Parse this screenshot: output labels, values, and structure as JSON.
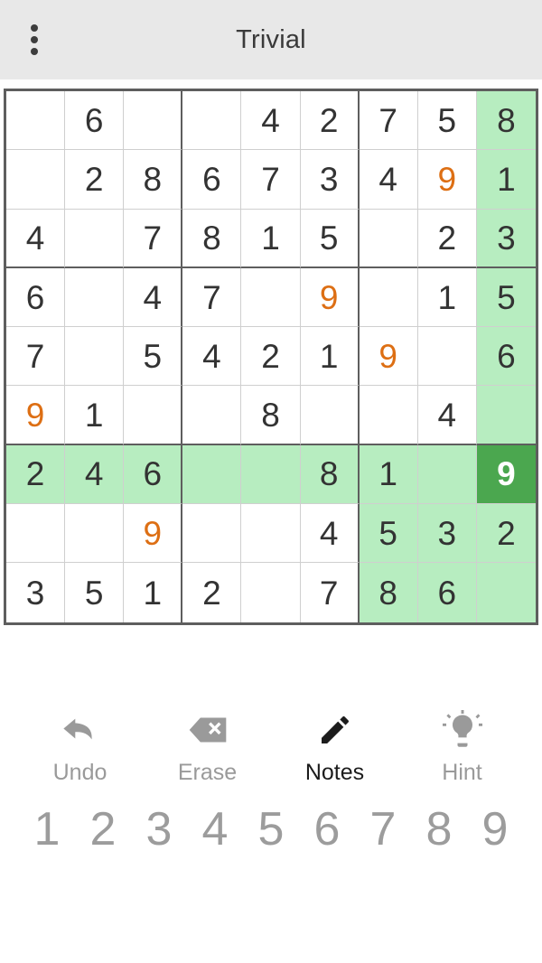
{
  "header": {
    "title": "Trivial",
    "menu_icon": "overflow-menu-icon"
  },
  "colors": {
    "accent_green": "#4BA74F",
    "highlight_green": "#B7EDC0",
    "user_entry_orange": "#DD6F14",
    "given_text": "#333333",
    "appbar_bg": "#E8E8E8",
    "grid_line": "#CFCFCF",
    "grid_border": "#5E5E5E",
    "numpad_text": "#9C9C9C"
  },
  "board": {
    "selected_cell": {
      "row": 6,
      "col": 8,
      "value": "9"
    },
    "rows": [
      [
        {
          "v": "",
          "t": "empty",
          "h": false
        },
        {
          "v": "6",
          "t": "given",
          "h": false
        },
        {
          "v": "",
          "t": "empty",
          "h": false
        },
        {
          "v": "",
          "t": "empty",
          "h": false
        },
        {
          "v": "4",
          "t": "given",
          "h": false
        },
        {
          "v": "2",
          "t": "given",
          "h": false
        },
        {
          "v": "7",
          "t": "given",
          "h": false
        },
        {
          "v": "5",
          "t": "given",
          "h": false
        },
        {
          "v": "8",
          "t": "given",
          "h": true
        }
      ],
      [
        {
          "v": "",
          "t": "empty",
          "h": false
        },
        {
          "v": "2",
          "t": "given",
          "h": false
        },
        {
          "v": "8",
          "t": "given",
          "h": false
        },
        {
          "v": "6",
          "t": "given",
          "h": false
        },
        {
          "v": "7",
          "t": "given",
          "h": false
        },
        {
          "v": "3",
          "t": "given",
          "h": false
        },
        {
          "v": "4",
          "t": "given",
          "h": false
        },
        {
          "v": "9",
          "t": "user",
          "h": false
        },
        {
          "v": "1",
          "t": "given",
          "h": true
        }
      ],
      [
        {
          "v": "4",
          "t": "given",
          "h": false
        },
        {
          "v": "",
          "t": "empty",
          "h": false
        },
        {
          "v": "7",
          "t": "given",
          "h": false
        },
        {
          "v": "8",
          "t": "given",
          "h": false
        },
        {
          "v": "1",
          "t": "given",
          "h": false
        },
        {
          "v": "5",
          "t": "given",
          "h": false
        },
        {
          "v": "",
          "t": "empty",
          "h": false
        },
        {
          "v": "2",
          "t": "given",
          "h": false
        },
        {
          "v": "3",
          "t": "given",
          "h": true
        }
      ],
      [
        {
          "v": "6",
          "t": "given",
          "h": false
        },
        {
          "v": "",
          "t": "empty",
          "h": false
        },
        {
          "v": "4",
          "t": "given",
          "h": false
        },
        {
          "v": "7",
          "t": "given",
          "h": false
        },
        {
          "v": "",
          "t": "empty",
          "h": false
        },
        {
          "v": "9",
          "t": "user",
          "h": false
        },
        {
          "v": "",
          "t": "empty",
          "h": false
        },
        {
          "v": "1",
          "t": "given",
          "h": false
        },
        {
          "v": "5",
          "t": "given",
          "h": true
        }
      ],
      [
        {
          "v": "7",
          "t": "given",
          "h": false
        },
        {
          "v": "",
          "t": "empty",
          "h": false
        },
        {
          "v": "5",
          "t": "given",
          "h": false
        },
        {
          "v": "4",
          "t": "given",
          "h": false
        },
        {
          "v": "2",
          "t": "given",
          "h": false
        },
        {
          "v": "1",
          "t": "given",
          "h": false
        },
        {
          "v": "9",
          "t": "user",
          "h": false
        },
        {
          "v": "",
          "t": "empty",
          "h": false
        },
        {
          "v": "6",
          "t": "given",
          "h": true
        }
      ],
      [
        {
          "v": "9",
          "t": "user",
          "h": false
        },
        {
          "v": "1",
          "t": "given",
          "h": false
        },
        {
          "v": "",
          "t": "empty",
          "h": false
        },
        {
          "v": "",
          "t": "empty",
          "h": false
        },
        {
          "v": "8",
          "t": "given",
          "h": false
        },
        {
          "v": "",
          "t": "empty",
          "h": false
        },
        {
          "v": "",
          "t": "empty",
          "h": false
        },
        {
          "v": "4",
          "t": "given",
          "h": false
        },
        {
          "v": "",
          "t": "empty",
          "h": true
        }
      ],
      [
        {
          "v": "2",
          "t": "given",
          "h": true
        },
        {
          "v": "4",
          "t": "given",
          "h": true
        },
        {
          "v": "6",
          "t": "given",
          "h": true
        },
        {
          "v": "",
          "t": "empty",
          "h": true
        },
        {
          "v": "",
          "t": "empty",
          "h": true
        },
        {
          "v": "8",
          "t": "given",
          "h": true
        },
        {
          "v": "1",
          "t": "given",
          "h": true
        },
        {
          "v": "",
          "t": "empty",
          "h": true
        },
        {
          "v": "9",
          "t": "selected",
          "h": true
        }
      ],
      [
        {
          "v": "",
          "t": "empty",
          "h": false
        },
        {
          "v": "",
          "t": "empty",
          "h": false
        },
        {
          "v": "9",
          "t": "user",
          "h": false
        },
        {
          "v": "",
          "t": "empty",
          "h": false
        },
        {
          "v": "",
          "t": "empty",
          "h": false
        },
        {
          "v": "4",
          "t": "given",
          "h": false
        },
        {
          "v": "5",
          "t": "given",
          "h": true
        },
        {
          "v": "3",
          "t": "given",
          "h": true
        },
        {
          "v": "2",
          "t": "given",
          "h": true
        }
      ],
      [
        {
          "v": "3",
          "t": "given",
          "h": false
        },
        {
          "v": "5",
          "t": "given",
          "h": false
        },
        {
          "v": "1",
          "t": "given",
          "h": false
        },
        {
          "v": "2",
          "t": "given",
          "h": false
        },
        {
          "v": "",
          "t": "empty",
          "h": false
        },
        {
          "v": "7",
          "t": "given",
          "h": false
        },
        {
          "v": "8",
          "t": "given",
          "h": true
        },
        {
          "v": "6",
          "t": "given",
          "h": true
        },
        {
          "v": "",
          "t": "empty",
          "h": true
        }
      ]
    ]
  },
  "actions": [
    {
      "label": "Undo",
      "icon": "undo-arrow-icon",
      "enabled": false
    },
    {
      "label": "Erase",
      "icon": "erase-icon",
      "enabled": false
    },
    {
      "label": "Notes",
      "icon": "pencil-icon",
      "enabled": true
    },
    {
      "label": "Hint",
      "icon": "lightbulb-icon",
      "enabled": false
    }
  ],
  "numpad": [
    "1",
    "2",
    "3",
    "4",
    "5",
    "6",
    "7",
    "8",
    "9"
  ]
}
